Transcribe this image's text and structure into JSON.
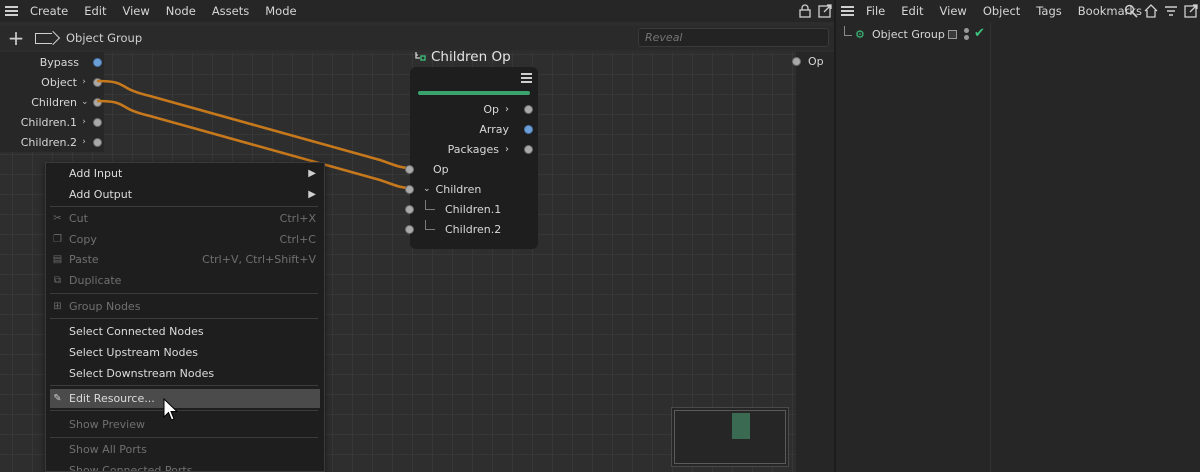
{
  "node_editor": {
    "menu": [
      "Create",
      "Edit",
      "View",
      "Node",
      "Assets",
      "Mode"
    ],
    "breadcrumb": "Object Group",
    "reveal_placeholder": "Reveal",
    "left_ports": [
      "Bypass",
      "Object",
      "Children",
      "Children.1",
      "Children.2"
    ],
    "right_port": "Op",
    "node": {
      "title": "Children Op",
      "outputs": [
        "Op",
        "Array",
        "Packages"
      ],
      "inputs": [
        "Op",
        "Children",
        "Children.1",
        "Children.2"
      ]
    },
    "context_menu": {
      "add_input": "Add Input",
      "add_output": "Add Output",
      "cut": "Cut",
      "cut_sc": "Ctrl+X",
      "copy": "Copy",
      "copy_sc": "Ctrl+C",
      "paste": "Paste",
      "paste_sc": "Ctrl+V, Ctrl+Shift+V",
      "duplicate": "Duplicate",
      "group_nodes": "Group Nodes",
      "select_connected": "Select Connected Nodes",
      "select_upstream": "Select Upstream Nodes",
      "select_downstream": "Select Downstream Nodes",
      "edit_resource": "Edit Resource...",
      "show_preview": "Show Preview",
      "show_all_ports": "Show All Ports",
      "show_connected_ports": "Show Connected Ports"
    }
  },
  "object_manager": {
    "menu": [
      "File",
      "Edit",
      "View",
      "Object",
      "Tags",
      "Bookmarks"
    ],
    "object_name": "Object Group"
  },
  "colors": {
    "wire": "#c5781c",
    "node_bar": "#3aa36d",
    "accent_green": "#3cc47c"
  }
}
